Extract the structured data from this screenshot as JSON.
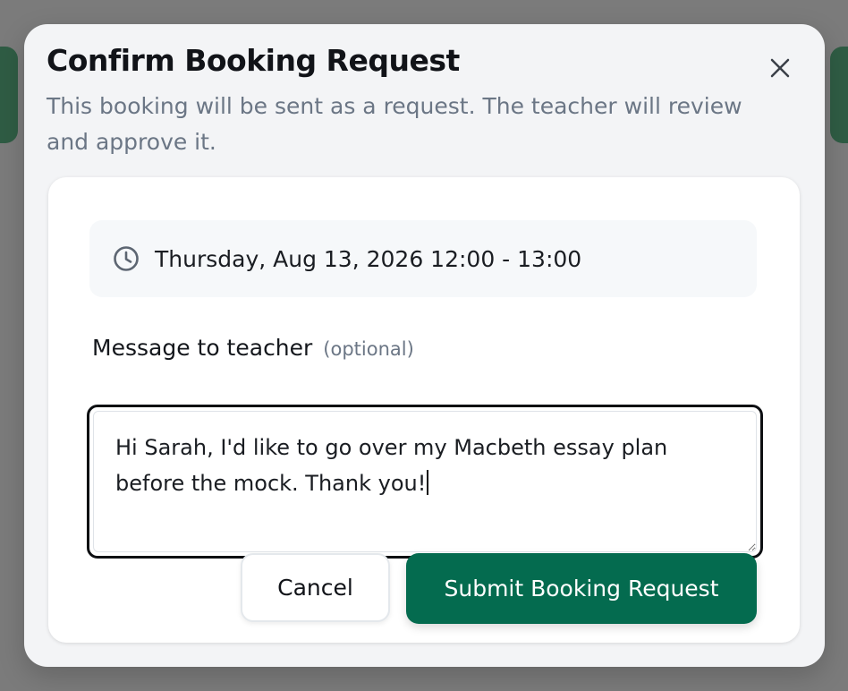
{
  "dialog": {
    "title": "Confirm Booking Request",
    "subtitle": "This booking will be sent as a request. The teacher will review and approve it.",
    "close_icon": "close-icon"
  },
  "booking": {
    "icon": "clock-icon",
    "datetime": "Thursday, Aug 13, 2026 12:00 - 13:00"
  },
  "message": {
    "label": "Message to teacher",
    "optional_hint": "(optional)",
    "value": "Hi Sarah, I'd like to go over my Macbeth essay plan before the mock. Thank you!"
  },
  "actions": {
    "cancel_label": "Cancel",
    "submit_label": "Submit Booking Request"
  },
  "colors": {
    "primary": "#046b4f",
    "overlay": "#7b7b7b",
    "modal_bg": "#f3f4f6",
    "subtitle_text": "#6b7685"
  }
}
